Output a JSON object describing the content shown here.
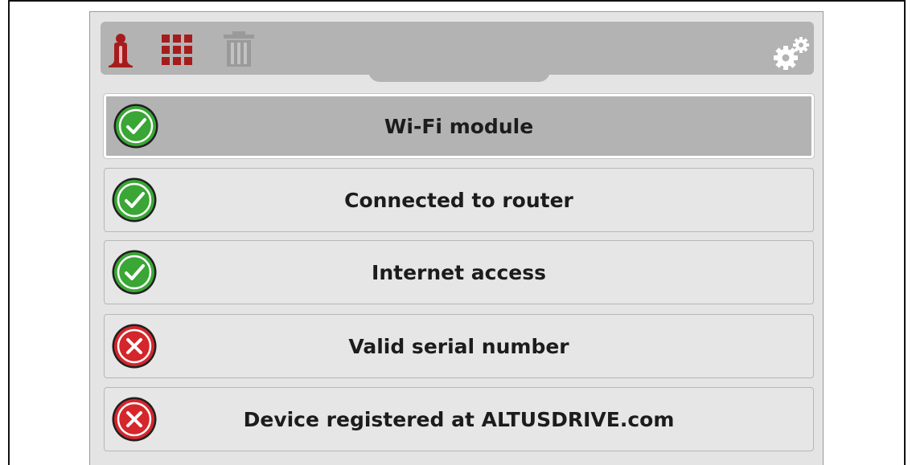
{
  "colors": {
    "accent_red": "#a61c1c",
    "ok_green": "#3aa635",
    "error_red": "#d4262b",
    "toolbar_gray": "#b3b3b3",
    "screen_gray": "#e4e4e4"
  },
  "toolbar": {
    "icons": [
      "info-icon",
      "grid-icon",
      "trash-icon",
      "gears-icon"
    ]
  },
  "status_items": [
    {
      "label": "Wi-Fi module",
      "status": "ok",
      "icon": "check-icon",
      "selected": true
    },
    {
      "label": "Connected to router",
      "status": "ok",
      "icon": "check-icon",
      "selected": false
    },
    {
      "label": "Internet access",
      "status": "ok",
      "icon": "check-icon",
      "selected": false
    },
    {
      "label": "Valid serial number",
      "status": "error",
      "icon": "cross-icon",
      "selected": false
    },
    {
      "label": "Device registered at ALTUSDRIVE.com",
      "status": "error",
      "icon": "cross-icon",
      "selected": false
    }
  ]
}
